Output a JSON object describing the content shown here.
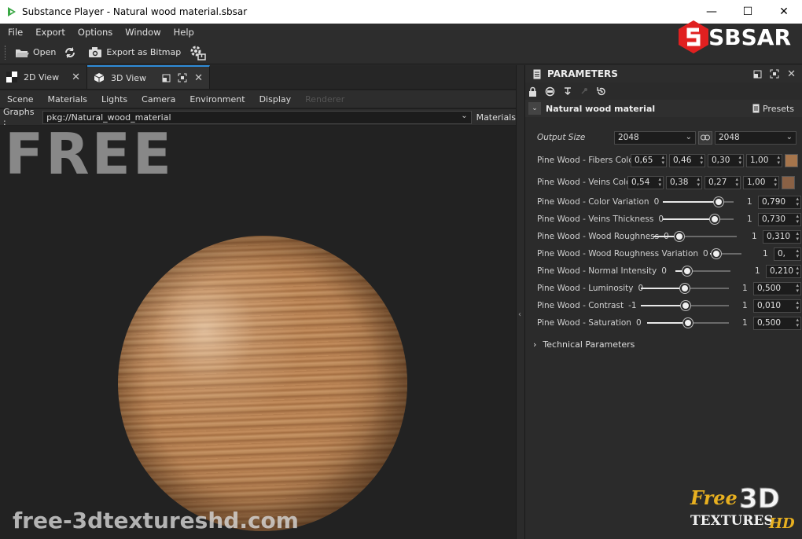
{
  "titlebar": {
    "title": "Substance Player - Natural wood material.sbsar",
    "minimize": "—",
    "maximize": "☐",
    "close": "✕"
  },
  "menu": [
    "File",
    "Export",
    "Options",
    "Window",
    "Help"
  ],
  "toolbar": {
    "open": "Open",
    "export_bitmap": "Export as Bitmap"
  },
  "brand": {
    "sbsar": "SBSAR"
  },
  "tabs": {
    "view2d": "2D View",
    "view3d": "3D View"
  },
  "subnav": [
    "Scene",
    "Materials",
    "Lights",
    "Camera",
    "Environment",
    "Display",
    "Renderer"
  ],
  "graphs": {
    "label": "Graphs :",
    "value": "pkg://Natural_wood_material",
    "materials": "Materials"
  },
  "viewport": {
    "free_label": "FREE",
    "watermark": "free-3dtextureshd.com"
  },
  "parameters": {
    "title": "PARAMETERS",
    "material_name": "Natural wood material",
    "presets": "Presets",
    "output_size": {
      "label": "Output Size",
      "width": "2048",
      "height": "2048"
    },
    "fibers": {
      "label": "Pine Wood - Fibers Color",
      "r": "0,65",
      "g": "0,46",
      "b": "0,30",
      "a": "1,00",
      "color": "#a6754c"
    },
    "veins": {
      "label": "Pine Wood - Veins Color",
      "r": "0,54",
      "g": "0,38",
      "b": "0,27",
      "a": "1,00",
      "color": "#8a6145"
    },
    "sliders": [
      {
        "label": "Pine Wood - Color Variation",
        "min": "0",
        "max": "1",
        "value": "0,790",
        "fraction": 0.79
      },
      {
        "label": "Pine Wood - Veins Thickness",
        "min": "0",
        "max": "1",
        "value": "0,730",
        "fraction": 0.73
      },
      {
        "label": "Pine Wood - Wood Roughness",
        "min": "0",
        "max": "1",
        "value": "0,310",
        "fraction": 0.31
      },
      {
        "label": "Pine Wood - Wood Roughness Variation",
        "min": "0",
        "max": "1",
        "value": "0,",
        "fraction": 0.2
      },
      {
        "label": "Pine Wood - Normal Intensity",
        "min": "0",
        "max": "1",
        "value": "0,210",
        "fraction": 0.21
      },
      {
        "label": "Pine Wood - Luminosity",
        "min": "0",
        "max": "1",
        "value": "0,500",
        "fraction": 0.5
      },
      {
        "label": "Pine Wood - Contrast",
        "min": "-1",
        "max": "1",
        "value": "0,010",
        "fraction": 0.505
      },
      {
        "label": "Pine Wood - Saturation",
        "min": "0",
        "max": "1",
        "value": "0,500",
        "fraction": 0.5
      }
    ],
    "technical": "Technical Parameters"
  },
  "corner_logo": {
    "free": "Free",
    "threed": "3D",
    "textures": "TEXTURES",
    "hd": "HD"
  }
}
